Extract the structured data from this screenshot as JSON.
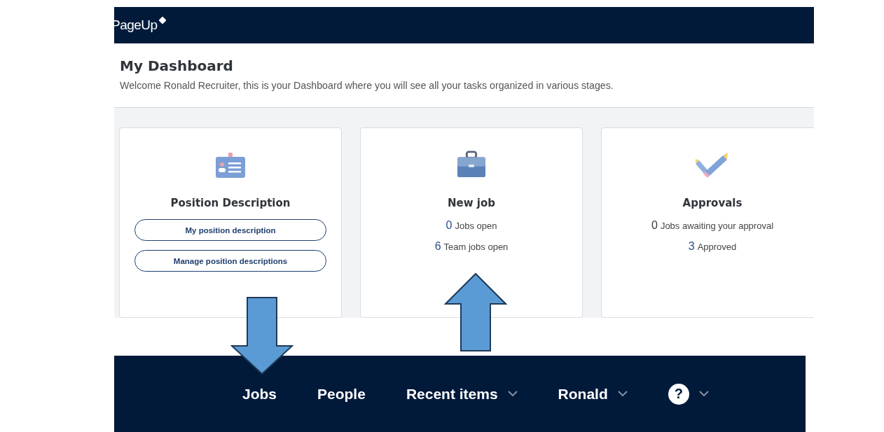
{
  "header": {
    "logo": "PageUp"
  },
  "dashboard": {
    "title": "My Dashboard",
    "welcome": "Welcome Ronald Recruiter, this is your Dashboard where you will see all your tasks organized in various stages."
  },
  "cards": [
    {
      "kind": "buttons",
      "title": "Position Description",
      "buttons": [
        "My position description",
        "Manage position descriptions"
      ]
    },
    {
      "kind": "stats",
      "title": "New job",
      "stats": [
        {
          "count": "0",
          "label": "Jobs open",
          "color": "#2b4f8c"
        },
        {
          "count": "6",
          "label": "Team jobs open",
          "color": "#2b4f8c"
        }
      ]
    },
    {
      "kind": "stats",
      "title": "Approvals",
      "stats": [
        {
          "count": "0",
          "label": "Jobs awaiting your approval",
          "color": "#333a40"
        },
        {
          "count": "3",
          "label": "Approved",
          "color": "#2b4f8c"
        }
      ]
    }
  ],
  "nav": [
    {
      "label": "Jobs",
      "dropdown": false
    },
    {
      "label": "People",
      "dropdown": false
    },
    {
      "label": "Recent items",
      "dropdown": true
    },
    {
      "label": "Ronald",
      "dropdown": true
    },
    {
      "label": "?",
      "dropdown": true,
      "kind": "help"
    }
  ],
  "annotations": [
    {
      "kind": "down-arrow"
    },
    {
      "kind": "up-arrow"
    }
  ]
}
